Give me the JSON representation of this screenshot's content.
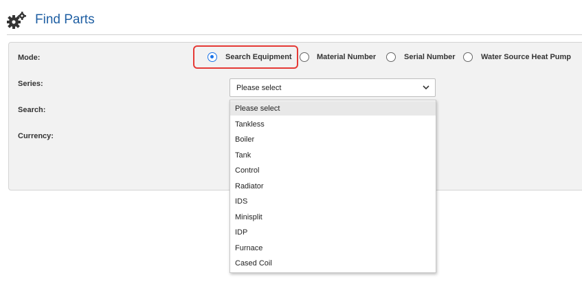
{
  "header": {
    "title": "Find Parts",
    "icon": "gears-icon"
  },
  "form": {
    "mode_label": "Mode:",
    "series_label": "Series:",
    "search_label": "Search:",
    "currency_label": "Currency:"
  },
  "mode_options": [
    {
      "label": "Search Equipment",
      "checked": true
    },
    {
      "label": "Material Number",
      "checked": false
    },
    {
      "label": "Serial Number",
      "checked": false
    },
    {
      "label": "Water Source Heat Pump",
      "checked": false
    }
  ],
  "series_select": {
    "value": "Please select",
    "options": [
      "Please select",
      "Tankless",
      "Boiler",
      "Tank",
      "Control",
      "Radiator",
      "IDS",
      "Minisplit",
      "IDP",
      "Furnace",
      "Cased Coil"
    ]
  },
  "colors": {
    "title": "#1f5fa3",
    "radio_checked": "#1a73e8",
    "highlight": "#e53935"
  }
}
